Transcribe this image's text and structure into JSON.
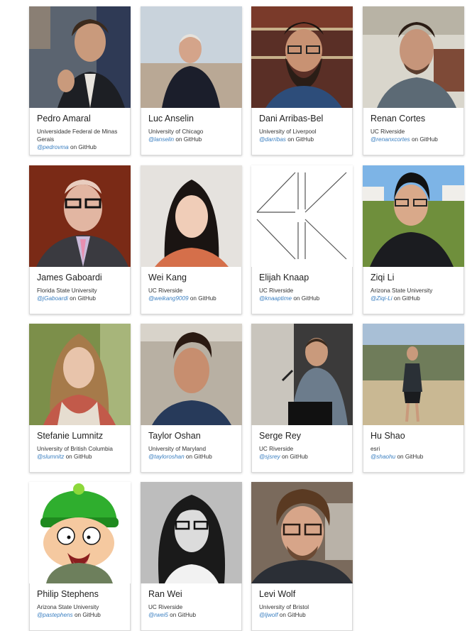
{
  "people": [
    {
      "name": "Pedro Amaral",
      "affiliation": "Universidade Federal de Minas Gerais",
      "handle": "@pedrovma",
      "suffix": "on GitHub"
    },
    {
      "name": "Luc Anselin",
      "affiliation": "University of Chicago",
      "handle": "@lanselin",
      "suffix": "on GitHub"
    },
    {
      "name": "Dani Arribas-Bel",
      "affiliation": "University of Liverpool",
      "handle": "@darribas",
      "suffix": "on GitHub"
    },
    {
      "name": "Renan Cortes",
      "affiliation": "UC Riverside",
      "handle": "@renanxcortes",
      "suffix": "on GitHub"
    },
    {
      "name": "James Gaboardi",
      "affiliation": "Florida State University",
      "handle": "@jGaboardi",
      "suffix": "on GitHub"
    },
    {
      "name": "Wei Kang",
      "affiliation": "UC Riverside",
      "handle": "@weikang9009",
      "suffix": "on GitHub"
    },
    {
      "name": "Elijah Knaap",
      "affiliation": "UC Riverside",
      "handle": "@knaaptime",
      "suffix": "on GitHub"
    },
    {
      "name": "Ziqi Li",
      "affiliation": "Arizona State University",
      "handle": "@Ziqi-Li",
      "suffix": "on GitHub"
    },
    {
      "name": "Stefanie Lumnitz",
      "affiliation": "University of British Columbia",
      "handle": "@slumnitz",
      "suffix": "on GitHub"
    },
    {
      "name": "Taylor Oshan",
      "affiliation": "University of Maryland",
      "handle": "@tayloroshan",
      "suffix": "on GitHub"
    },
    {
      "name": "Serge Rey",
      "affiliation": "UC Riverside",
      "handle": "@sjsrey",
      "suffix": "on GitHub"
    },
    {
      "name": "Hu Shao",
      "affiliation": "esri",
      "handle": "@shaohu",
      "suffix": "on GitHub"
    },
    {
      "name": "Philip Stephens",
      "affiliation": "Arizona State University",
      "handle": "@pastephens",
      "suffix": "on GitHub"
    },
    {
      "name": "Ran Wei",
      "affiliation": "UC Riverside",
      "handle": "@rwei5",
      "suffix": "on GitHub"
    },
    {
      "name": "Levi Wolf",
      "affiliation": "University of Bristol",
      "handle": "@ljwolf",
      "suffix": "on GitHub"
    }
  ],
  "colors": {
    "link": "#3a7fc1",
    "card_border": "#d9d9d9",
    "name_text": "#222222"
  },
  "icons": [
    "avatar-photo",
    "identicon-avatar",
    "cartoon-avatar"
  ]
}
